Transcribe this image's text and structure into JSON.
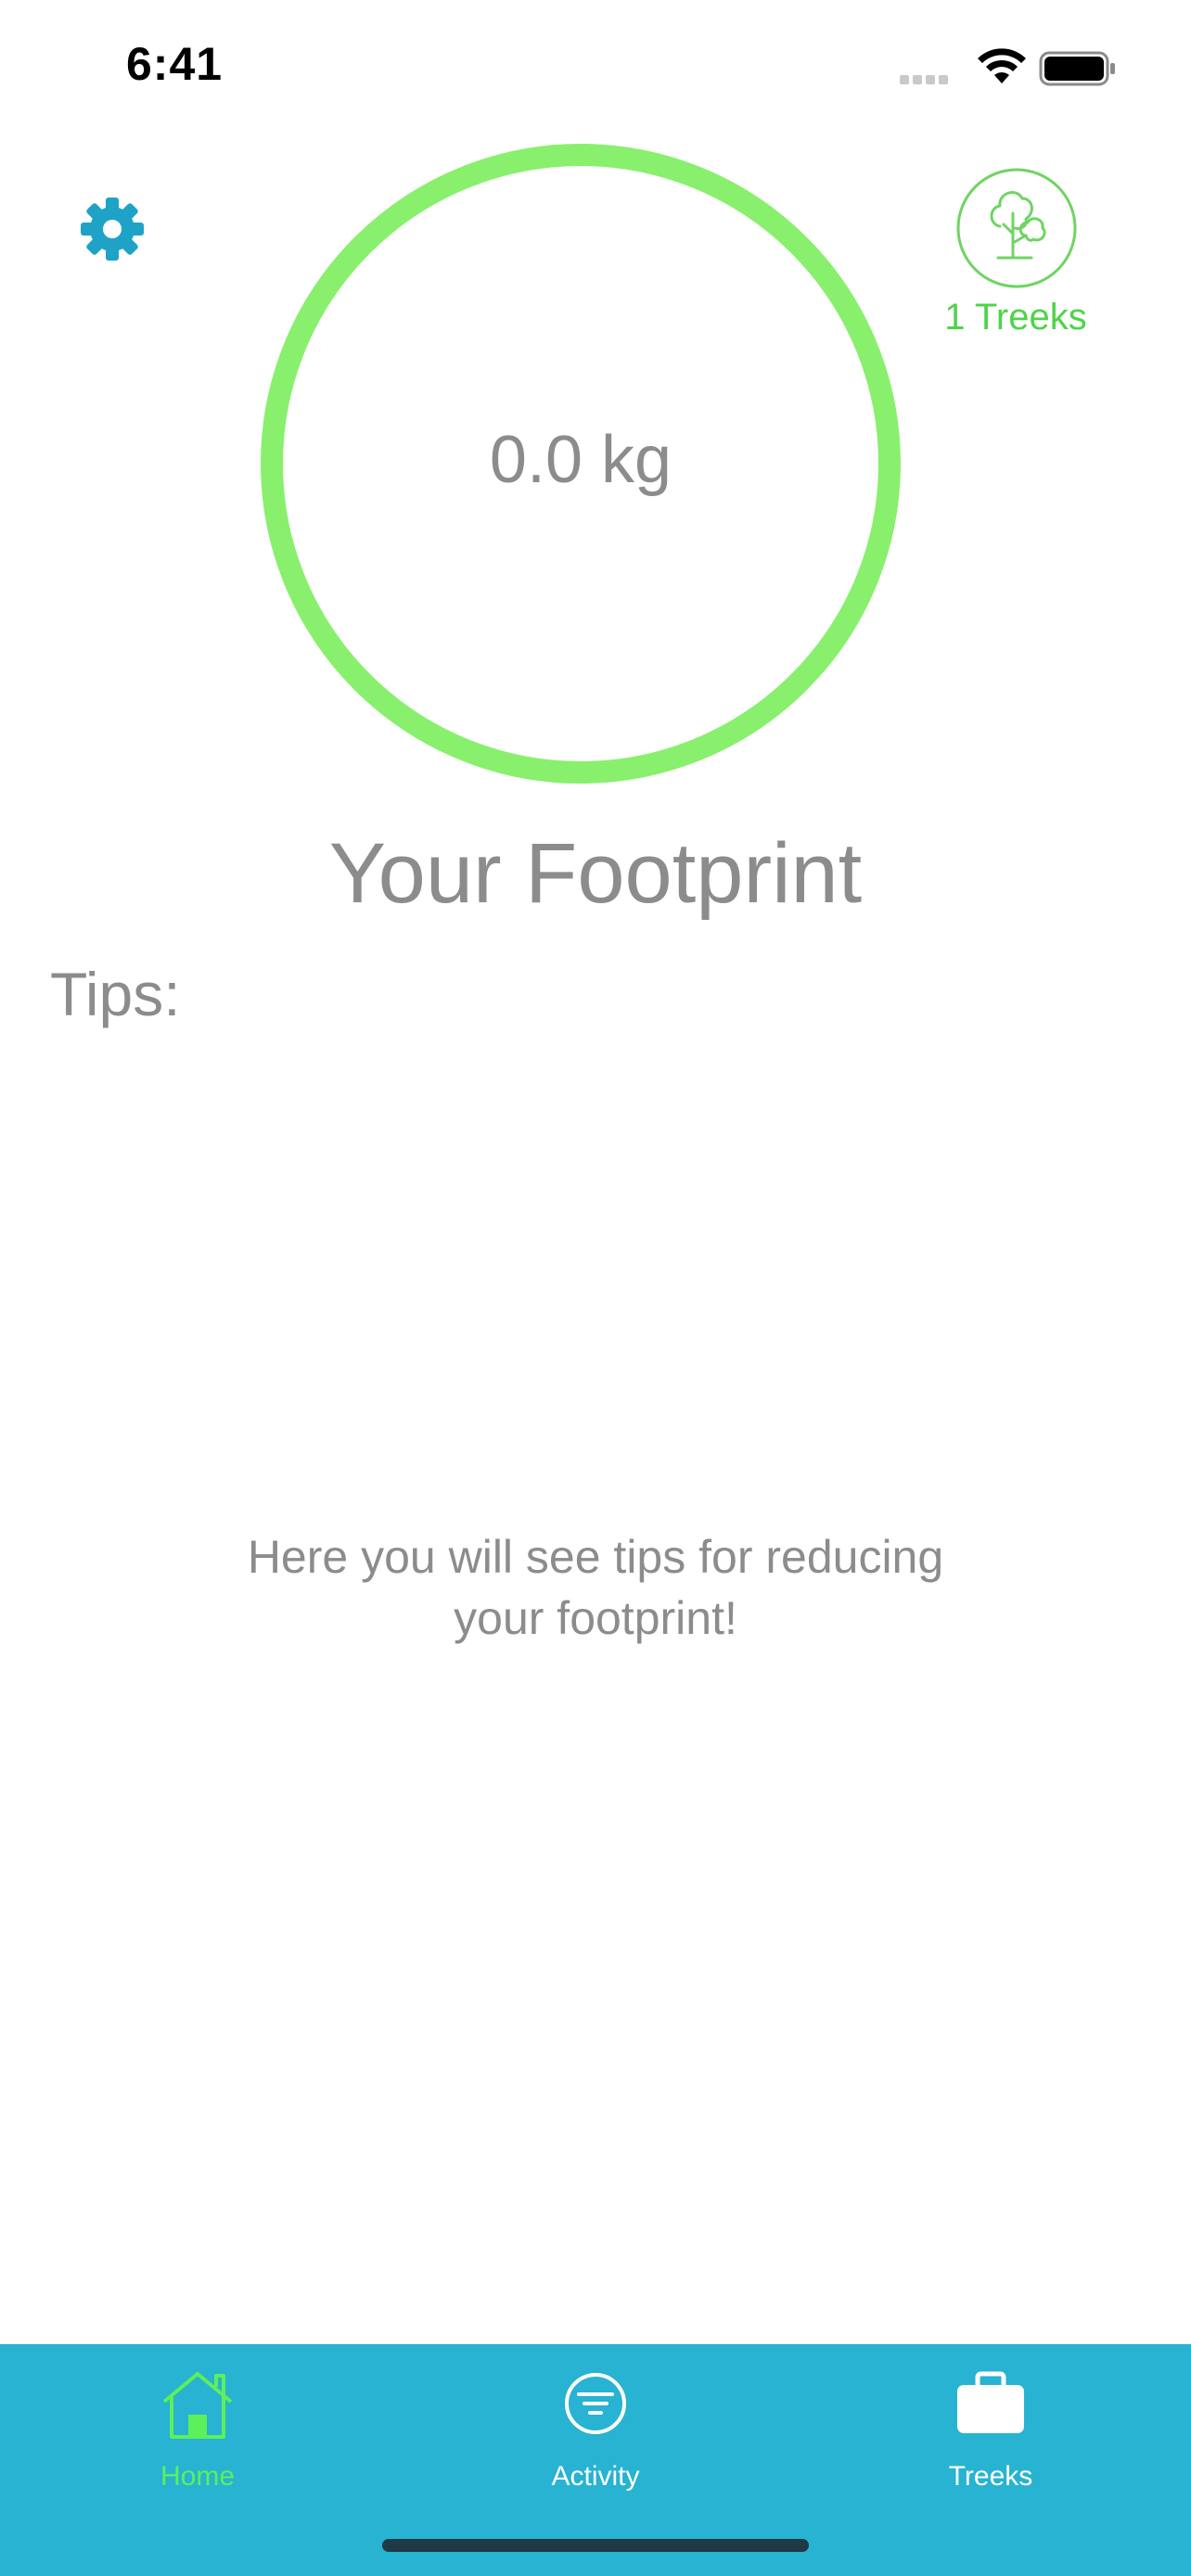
{
  "status_bar": {
    "time": "6:41"
  },
  "header": {
    "settings_icon": "gear-icon",
    "treeks_icon": "tree-icon",
    "treeks_count": "1 Treeks"
  },
  "footprint": {
    "value": "0.0 kg",
    "title": "Your Footprint",
    "ring_color": "#88f06c"
  },
  "tips": {
    "label": "Tips:",
    "placeholder_line1": "Here you will see tips for reducing",
    "placeholder_line2": "your footprint!"
  },
  "tab_bar": {
    "background": "#27b3d1",
    "active_color": "#5cf05a",
    "tabs": [
      {
        "label": "Home",
        "icon": "home-icon",
        "active": true
      },
      {
        "label": "Activity",
        "icon": "filter-icon",
        "active": false
      },
      {
        "label": "Treeks",
        "icon": "briefcase-icon",
        "active": false
      }
    ]
  }
}
